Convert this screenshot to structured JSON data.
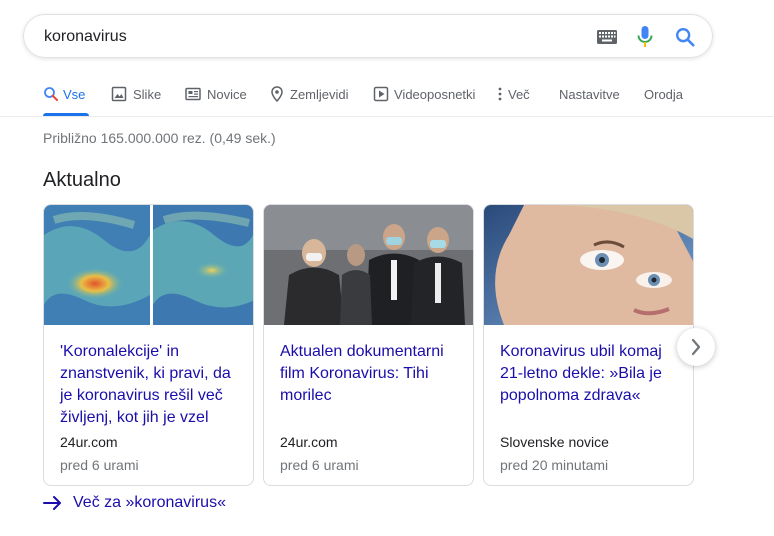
{
  "search": {
    "query": "koronavirus"
  },
  "tabs": [
    {
      "label": "Vse",
      "icon": "search-icon",
      "active": true
    },
    {
      "label": "Slike",
      "icon": "image-icon"
    },
    {
      "label": "Novice",
      "icon": "newspaper-icon"
    },
    {
      "label": "Zemljevidi",
      "icon": "map-pin-icon"
    },
    {
      "label": "Videoposnetki",
      "icon": "play-icon"
    },
    {
      "label": "Več",
      "icon": "more-vert-icon"
    },
    {
      "label": "Nastavitve"
    },
    {
      "label": "Orodja"
    }
  ],
  "results": {
    "stats": "Približno 165.000.000 rez. (0,49 sek.)"
  },
  "top_stories": {
    "title": "Aktualno",
    "cards": [
      {
        "headline": "'Koronalekcije' in znanstvenik, ki pravi, da je koronavirus rešil več življenj, kot jih je vzel",
        "source": "24ur.com",
        "time": "pred 6 urami"
      },
      {
        "headline": "Aktualen dokumentarni film Koronavirus: Tihi morilec",
        "source": "24ur.com",
        "time": "pred 6 urami"
      },
      {
        "headline": "Koronavirus ubil komaj 21-letno dekle: »Bila je popolnoma zdrava«",
        "source": "Slovenske novice",
        "time": "pred 20 minutami"
      }
    ],
    "more_label": "Več za »koronavirus«"
  },
  "colors": {
    "link": "#1a0dab",
    "accent": "#1a73e8",
    "secondary_text": "#70757a"
  }
}
